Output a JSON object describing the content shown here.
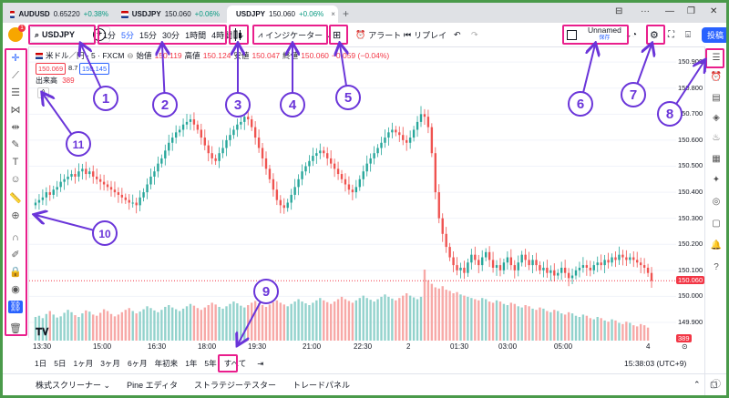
{
  "browser": {
    "tabs": [
      {
        "symbol": "AUDUSD",
        "price": "0.65220",
        "change": "+0.38%"
      },
      {
        "symbol": "USDJPY",
        "price": "150.060",
        "change": "+0.06%"
      },
      {
        "symbol": "USDJPY",
        "price": "150.060",
        "change": "+0.06%"
      }
    ],
    "close_glyph": "×",
    "new_tab_glyph": "+"
  },
  "toolbar": {
    "avatar_badge": "1",
    "symbol": "USDJPY",
    "intervals": [
      "1分",
      "5分",
      "15分",
      "30分",
      "1時間",
      "4時間"
    ],
    "selected_interval": "5分",
    "indicator_label": "インジケーター",
    "alert_label": "アラート",
    "replay_label": "リプレイ",
    "layout_name": "Unnamed",
    "layout_sub": "保存",
    "post_label": "投稿"
  },
  "legend": {
    "title": "米ドル／円 · 5 · FXCM",
    "open_label": "始値",
    "open": "150.119",
    "high_label": "高値",
    "high": "150.124",
    "low_label": "安値",
    "low": "150.047",
    "close_label": "終値",
    "close": "150.060",
    "change": "−0.059 (−0.04%)",
    "bid": "150.069",
    "spread": "8.7",
    "ask": "150.145",
    "volume_label": "出来高",
    "volume": "389"
  },
  "price_axis": {
    "labels": [
      "150.900",
      "150.800",
      "150.700",
      "150.600",
      "150.500",
      "150.400",
      "150.300",
      "150.200",
      "150.100",
      "150.000",
      "149.900"
    ],
    "current_price": "150.060",
    "current_volume": "389"
  },
  "time_axis": {
    "labels": [
      "13:30",
      "15:00",
      "16:30",
      "18:00",
      "19:30",
      "21:00",
      "22:30",
      "2",
      "01:30",
      "03:00",
      "05:00",
      "4"
    ]
  },
  "range_bar": {
    "ranges": [
      "1日",
      "5日",
      "1ヶ月",
      "3ヶ月",
      "6ヶ月",
      "年初来",
      "1年",
      "5年",
      "すべて"
    ],
    "clock": "15:38:03 (UTC+9)",
    "log_label": "%",
    "log2_label": "log",
    "auto_label": "auto"
  },
  "bottom_bar": {
    "tabs": [
      "株式スクリーナー",
      "Pine エディタ",
      "ストラテジーテスター",
      "トレードパネル"
    ]
  },
  "annotations": [
    "1",
    "2",
    "3",
    "4",
    "5",
    "6",
    "7",
    "8",
    "9",
    "10",
    "11"
  ],
  "colors": {
    "up": "#26a69a",
    "down": "#ef5350",
    "highlight": "#e91e8c",
    "accent": "#2962ff",
    "annotation": "#6a35d9"
  },
  "chart_data": {
    "type": "candlestick",
    "ylim": [
      149.83,
      150.96
    ],
    "closes": [
      150.36,
      150.37,
      150.38,
      150.4,
      150.39,
      150.41,
      150.42,
      150.44,
      150.45,
      150.46,
      150.47,
      150.46,
      150.48,
      150.49,
      150.47,
      150.48,
      150.46,
      150.45,
      150.44,
      150.43,
      150.42,
      150.41,
      150.4,
      150.39,
      150.38,
      150.37,
      150.36,
      150.36,
      150.35,
      150.38,
      150.4,
      150.43,
      150.46,
      150.48,
      150.51,
      150.53,
      150.56,
      150.59,
      150.61,
      150.63,
      150.64,
      150.66,
      150.67,
      150.68,
      150.66,
      150.64,
      150.61,
      150.58,
      150.55,
      150.53,
      150.52,
      150.55,
      150.57,
      150.6,
      150.62,
      150.64,
      150.66,
      150.67,
      150.69,
      150.68,
      150.65,
      150.61,
      150.57,
      150.53,
      150.49,
      150.45,
      150.41,
      150.37,
      150.35,
      150.34,
      150.36,
      150.39,
      150.42,
      150.45,
      150.48,
      150.5,
      150.52,
      150.54,
      150.55,
      150.56,
      150.55,
      150.53,
      150.51,
      150.49,
      150.47,
      150.45,
      150.43,
      150.41,
      150.4,
      150.42,
      150.45,
      150.48,
      150.51,
      150.53,
      150.55,
      150.57,
      150.59,
      150.61,
      150.63,
      150.64,
      150.63,
      150.62,
      150.6,
      150.59,
      150.61,
      150.64,
      150.67,
      150.7,
      150.69,
      150.65,
      150.55,
      150.4,
      150.3,
      150.24,
      150.19,
      150.15,
      150.12,
      150.1,
      150.11,
      150.09,
      150.13,
      150.16,
      150.14,
      150.12,
      150.15,
      150.17,
      150.14,
      150.11,
      150.12,
      150.1,
      150.13,
      150.15,
      150.12,
      150.1,
      150.13,
      150.16,
      150.14,
      150.12,
      150.14,
      150.12,
      150.1,
      150.11,
      150.09,
      150.1,
      150.08,
      150.09,
      150.11,
      150.09,
      150.07,
      150.08,
      150.1,
      150.11,
      150.12,
      150.11,
      150.1,
      150.12,
      150.13,
      150.12,
      150.14,
      150.13,
      150.15,
      150.14,
      150.16,
      150.15,
      150.14,
      150.15,
      150.14,
      150.13,
      150.12,
      150.11,
      150.09,
      150.06
    ],
    "volumes": [
      40,
      42,
      38,
      45,
      50,
      44,
      39,
      41,
      47,
      52,
      48,
      43,
      40,
      46,
      51,
      49,
      44,
      42,
      47,
      53,
      50,
      45,
      41,
      44,
      48,
      52,
      55,
      50,
      46,
      49,
      53,
      58,
      55,
      51,
      48,
      52,
      57,
      60,
      56,
      53,
      50,
      54,
      58,
      62,
      59,
      55,
      52,
      56,
      60,
      64,
      61,
      57,
      54,
      58,
      62,
      66,
      63,
      59,
      56,
      60,
      64,
      67,
      63,
      60,
      57,
      61,
      65,
      68,
      64,
      61,
      58,
      62,
      66,
      70,
      66,
      63,
      60,
      64,
      68,
      72,
      68,
      65,
      62,
      66,
      70,
      74,
      70,
      67,
      64,
      68,
      72,
      76,
      72,
      69,
      66,
      70,
      74,
      78,
      74,
      71,
      68,
      72,
      76,
      80,
      76,
      73,
      70,
      74,
      120,
      102,
      96,
      90,
      88,
      92,
      86,
      84,
      80,
      82,
      78,
      76,
      74,
      72,
      70,
      68,
      72,
      70,
      66,
      64,
      68,
      66,
      62,
      60,
      64,
      62,
      58,
      56,
      60,
      58,
      54,
      52,
      56,
      54,
      50,
      48,
      52,
      50,
      46,
      44,
      48,
      46,
      42,
      40,
      44,
      42,
      38,
      36,
      40,
      38,
      34,
      32,
      36,
      34,
      30,
      28,
      32,
      30,
      26,
      24,
      28,
      26,
      22
    ]
  }
}
